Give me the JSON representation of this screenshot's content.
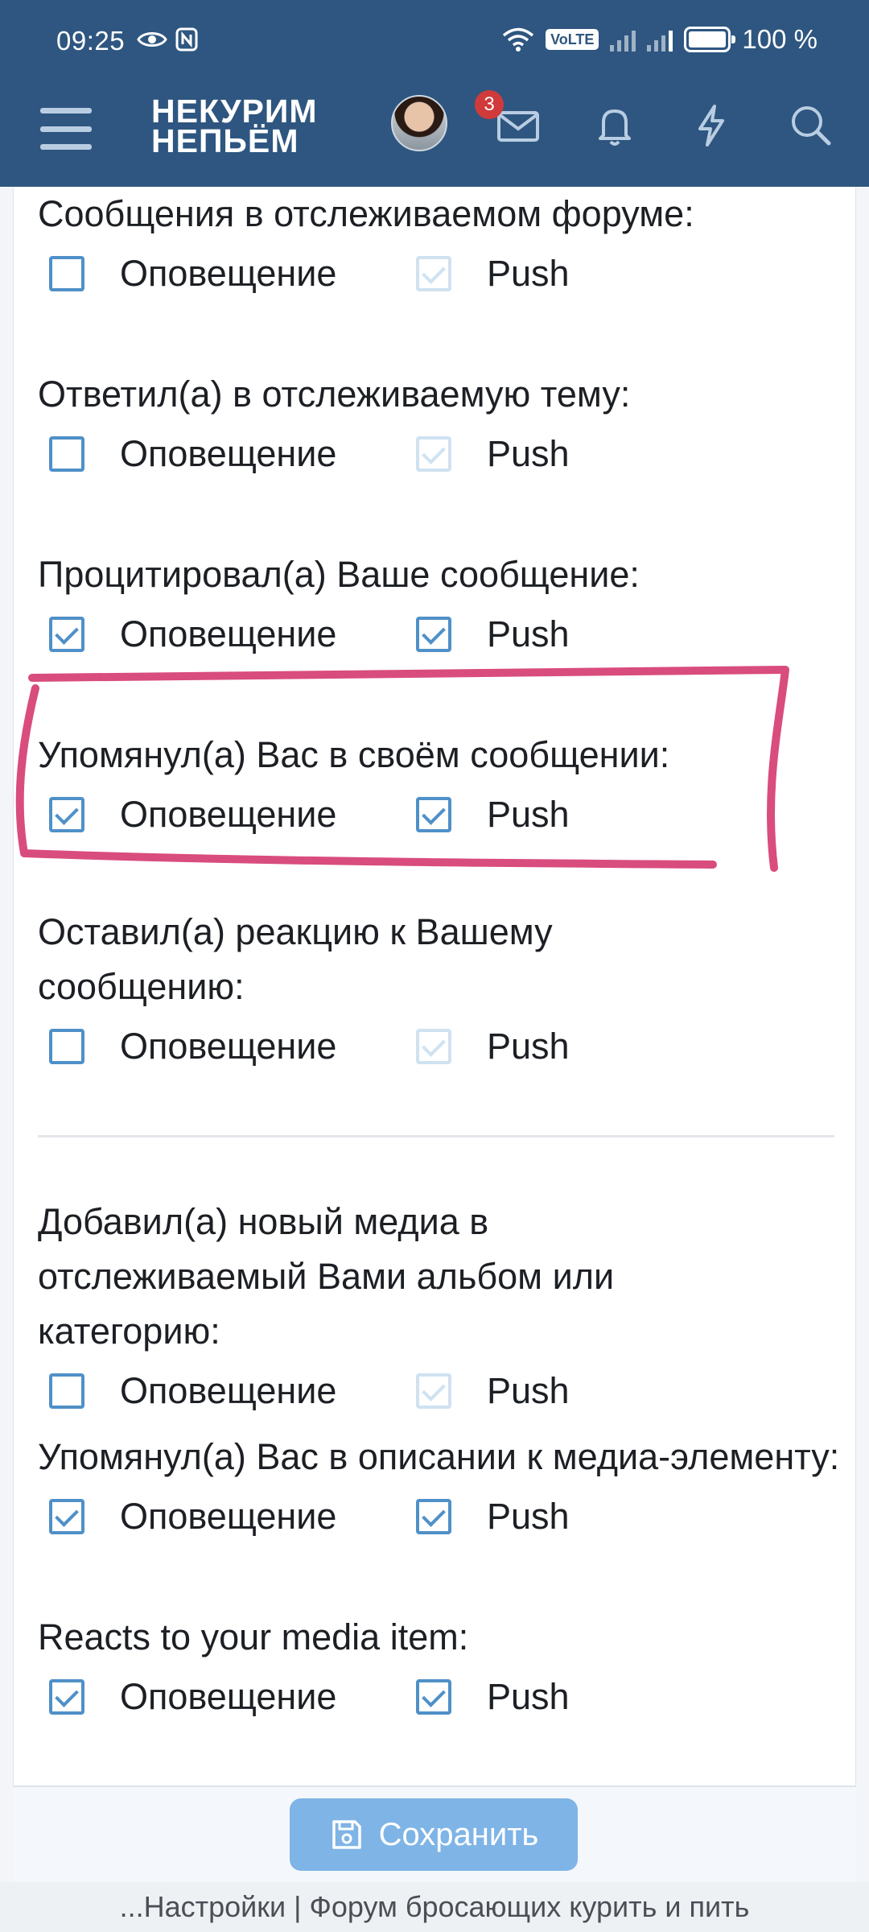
{
  "status_bar": {
    "time": "09:25",
    "network": "VoLTE",
    "battery": "100 %"
  },
  "header": {
    "logo_line1": "НЕКУРИМ",
    "logo_line2": "НЕПЬЁМ",
    "inbox_badge": "3"
  },
  "preferences": [
    {
      "label": "Сообщения в отслеживаемом форуме:",
      "alert_checked": false,
      "push_checked": true,
      "push_disabled": true
    },
    {
      "label": "Ответил(а) в отслеживаемую тему:",
      "alert_checked": false,
      "push_checked": true,
      "push_disabled": true
    },
    {
      "label": "Процитировал(а) Ваше сообщение:",
      "alert_checked": true,
      "push_checked": true,
      "push_disabled": false
    },
    {
      "label": "Упомянул(а) Вас в своём сообщении:",
      "alert_checked": true,
      "push_checked": true,
      "push_disabled": false
    },
    {
      "label": "Оставил(а) реакцию к Вашему сообщению:",
      "alert_checked": false,
      "push_checked": true,
      "push_disabled": true
    },
    {
      "label": "Добавил(а) новый медиа в отслеживаемый Вами альбом или категорию:",
      "alert_checked": false,
      "push_checked": true,
      "push_disabled": true
    },
    {
      "label": "Упомянул(а) Вас в описании к медиа-элементу:",
      "alert_checked": true,
      "push_checked": true,
      "push_disabled": false
    },
    {
      "label": "Reacts to your media item:",
      "alert_checked": true,
      "push_checked": true,
      "push_disabled": false
    }
  ],
  "option_labels": {
    "alert": "Оповещение",
    "push": "Push"
  },
  "save_label": "Сохранить",
  "page_title": "...Настройки | Форум бросающих курить и пить",
  "colors": {
    "header_bg": "#2e5680",
    "checkbox": "#4f90c8",
    "checkbox_disabled": "#cfe2f1",
    "save_button": "#7fb4e6",
    "annotation": "#d94c7e"
  }
}
